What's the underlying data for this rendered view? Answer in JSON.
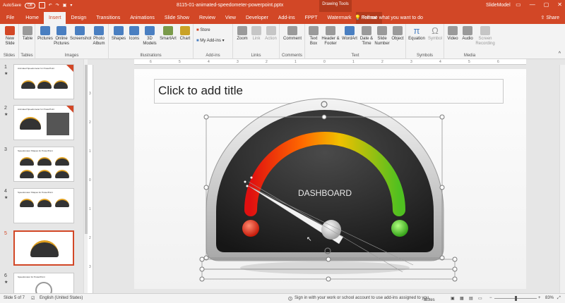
{
  "titlebar": {
    "autosave": "AutoSave",
    "autosave_state": "Off",
    "doc_title": "8115-01-animated-speedometer-powerpoint.pptx",
    "context_group": "Drawing Tools",
    "account": "SlideModel"
  },
  "tabs": [
    "File",
    "Home",
    "Insert",
    "Design",
    "Transitions",
    "Animations",
    "Slide Show",
    "Review",
    "View",
    "Developer",
    "Add-ins",
    "FPPT",
    "Watermark",
    "Format"
  ],
  "active_tab": "Insert",
  "tell_me": "Tell me what you want to do",
  "share": "Share",
  "ribbon": {
    "groups": [
      {
        "label": "Slides",
        "buttons": [
          "New Slide",
          "Table"
        ]
      },
      {
        "label": "Tables",
        "buttons": [
          "Table"
        ]
      },
      {
        "label": "Images",
        "buttons": [
          "Pictures",
          "Online Pictures",
          "Screenshot",
          "Photo Album"
        ]
      },
      {
        "label": "Illustrations",
        "buttons": [
          "Shapes",
          "Icons",
          "3D Models",
          "SmartArt",
          "Chart"
        ]
      },
      {
        "label": "Add-ins",
        "buttons": [
          "Store",
          "My Add-ins"
        ]
      },
      {
        "label": "Links",
        "buttons": [
          "Zoom",
          "Link",
          "Action"
        ]
      },
      {
        "label": "Comments",
        "buttons": [
          "Comment"
        ]
      },
      {
        "label": "Text",
        "buttons": [
          "Text Box",
          "Header & Footer",
          "WordArt",
          "Date & Time",
          "Slide Number",
          "Object"
        ]
      },
      {
        "label": "Symbols",
        "buttons": [
          "Equation",
          "Symbol"
        ]
      },
      {
        "label": "Media",
        "buttons": [
          "Video",
          "Audio",
          "Screen Recording"
        ]
      }
    ]
  },
  "thumbnails": [
    {
      "num": "1",
      "title": "Animated Speedometer for PowerPoint",
      "star": "★"
    },
    {
      "num": "2",
      "title": "Animated Speedometer for PowerPoint",
      "star": "★"
    },
    {
      "num": "3",
      "title": "Speedometer Shapes for PowerPoint",
      "star": "★"
    },
    {
      "num": "4",
      "title": "Speedometer Shapes for PowerPoint",
      "star": "★"
    },
    {
      "num": "5",
      "title": "",
      "star": ""
    },
    {
      "num": "6",
      "title": "Speedometer for PowerPoint",
      "star": "★"
    }
  ],
  "selected_slide": "5",
  "slide": {
    "title_placeholder": "Click to add title",
    "gauge_label": "DASHBOARD"
  },
  "hruler_ticks": [
    "6",
    "5",
    "4",
    "3",
    "2",
    "1",
    "0",
    "1",
    "2",
    "3",
    "4",
    "5",
    "6"
  ],
  "vruler_ticks": [
    "3",
    "2",
    "1",
    "0",
    "1",
    "2",
    "3"
  ],
  "status": {
    "slide_info": "Slide 5 of 7",
    "language": "English (United States)",
    "signin": "Sign in with your work or school account to use add-ins assigned to you.",
    "notes": "Notes",
    "zoom": "83%"
  },
  "colors": {
    "accent": "#d24726",
    "ribbon_bg": "#f3f3f3"
  }
}
